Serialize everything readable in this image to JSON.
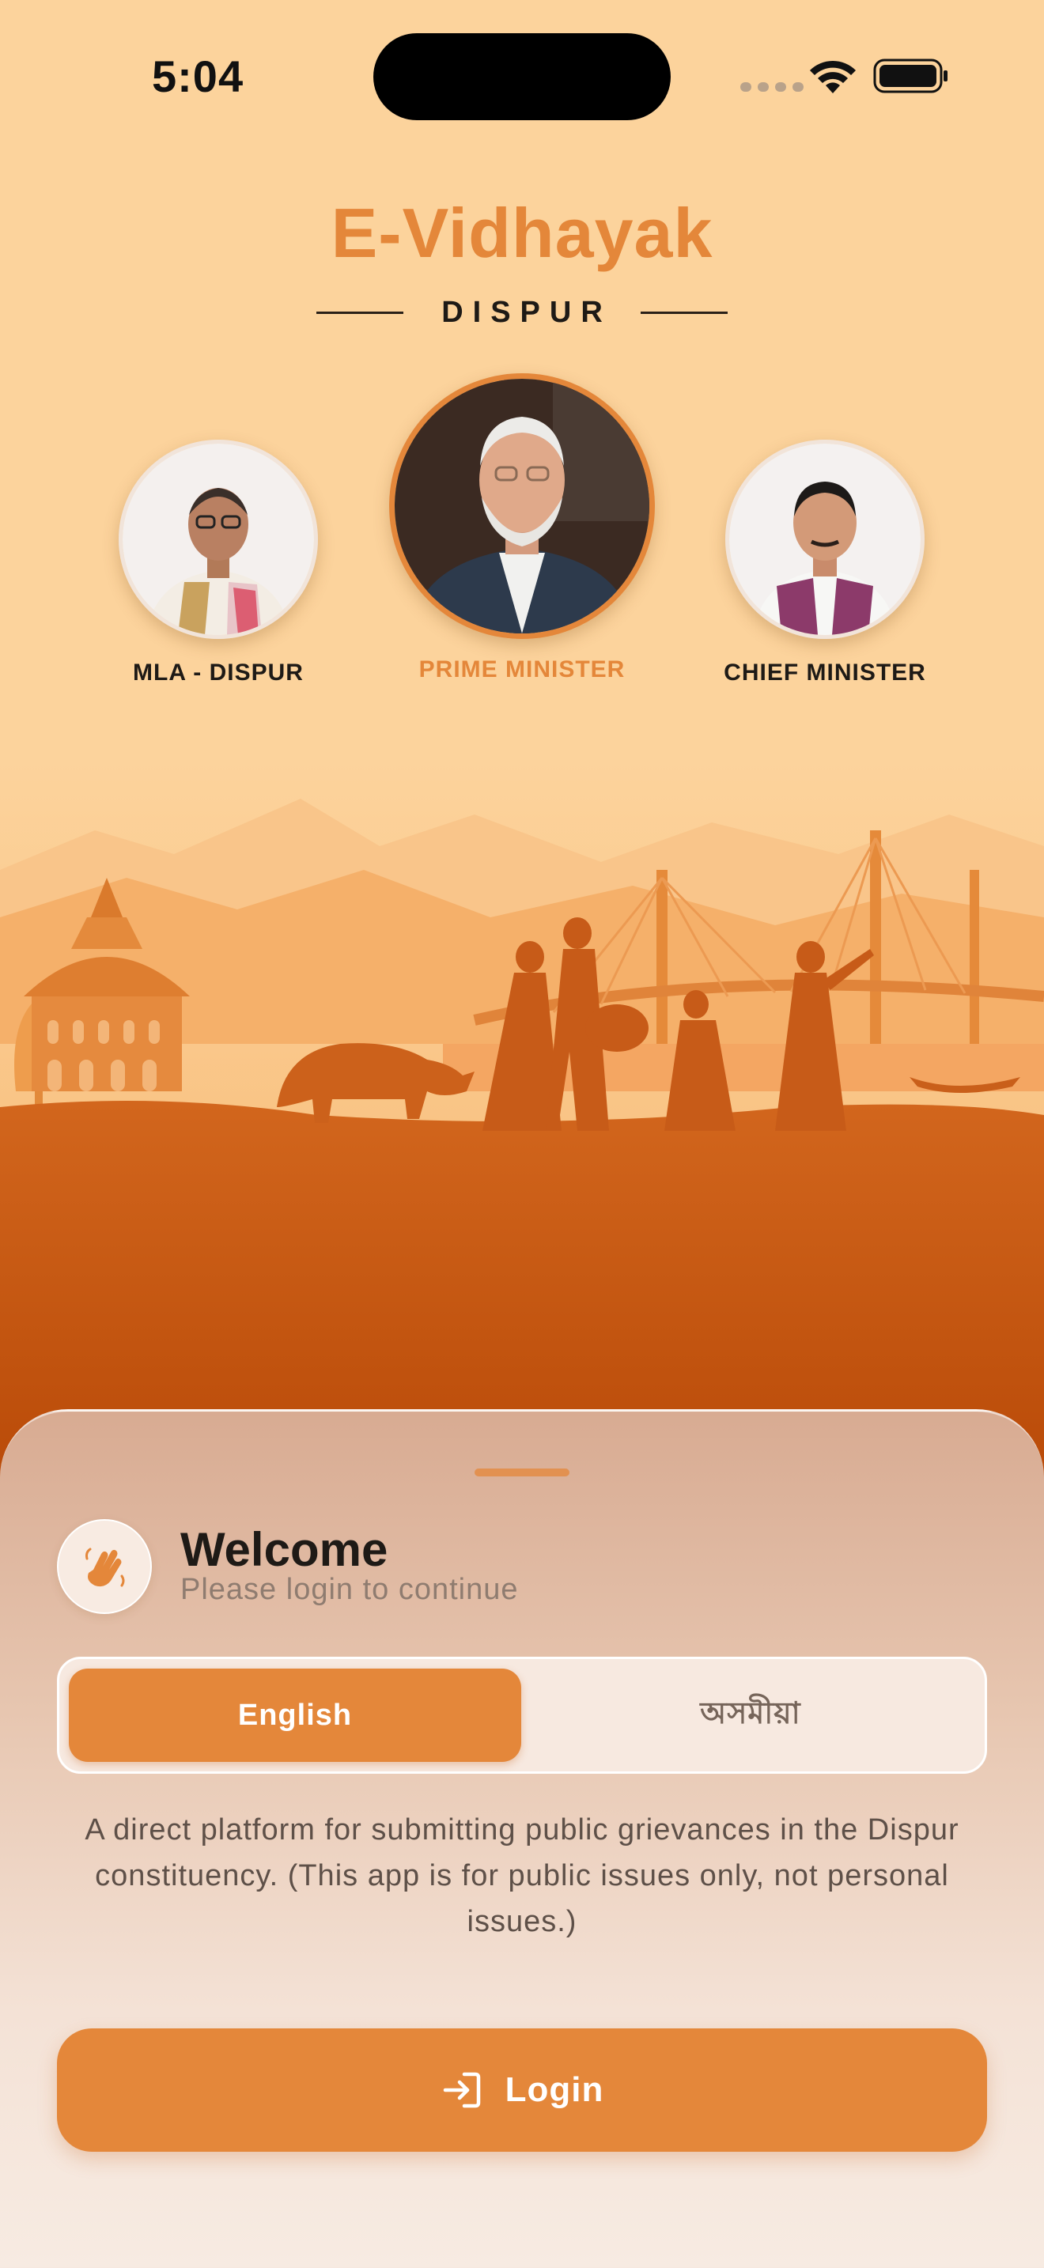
{
  "status_bar": {
    "time": "5:04"
  },
  "header": {
    "title": "E-Vidhayak",
    "subtitle": "DISPUR"
  },
  "leaders": [
    {
      "label": "MLA - DISPUR",
      "active": false
    },
    {
      "label": "PRIME MINISTER",
      "active": true
    },
    {
      "label": "CHIEF MINISTER",
      "active": false
    }
  ],
  "welcome": {
    "title": "Welcome",
    "subtitle": "Please login to continue",
    "icon": "waving-hand-icon"
  },
  "language_toggle": {
    "options": [
      "English",
      "অসমীয়া"
    ],
    "selected": "English"
  },
  "description": "A direct platform for submitting public grievances in the Dispur constituency. (This app is for public issues only, not personal issues.)",
  "login_button": {
    "label": "Login",
    "icon": "login-icon"
  },
  "colors": {
    "accent": "#e4873a",
    "background": "#fcd39c",
    "ground": "#bd4d0a"
  }
}
